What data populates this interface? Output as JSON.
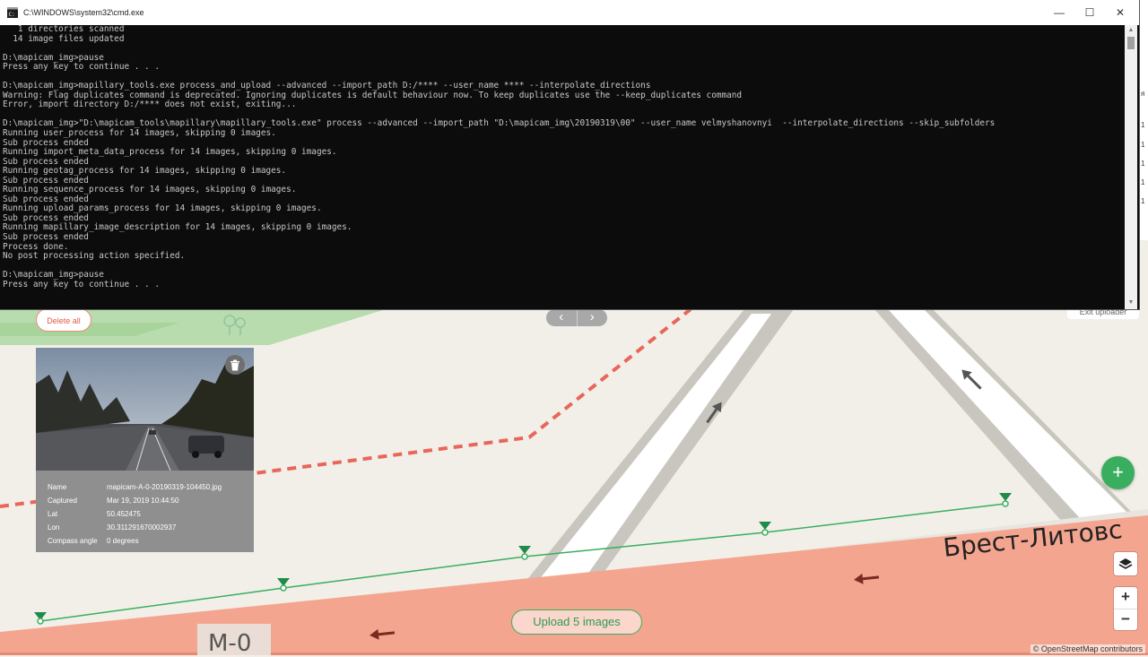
{
  "cmd": {
    "title": "C:\\WINDOWS\\system32\\cmd.exe",
    "controls": {
      "minimize": "—",
      "maximize": "☐",
      "close": "✕"
    },
    "lines": [
      "   1 directories scanned",
      "  14 image files updated",
      "",
      "D:\\mapicam_img>pause",
      "Press any key to continue . . .",
      "",
      "D:\\mapicam_img>mapillary_tools.exe process_and_upload --advanced --import_path D:/**** --user_name **** --interpolate_directions",
      "Warning: Flag duplicates command is deprecated. Ignoring duplicates is default behaviour now. To keep duplicates use the --keep_duplicates command",
      "Error, import directory D:/**** does not exist, exiting...",
      "",
      "D:\\mapicam_img>\"D:\\mapicam_tools\\mapillary\\mapillary_tools.exe\" process --advanced --import_path \"D:\\mapicam_img\\20190319\\00\" --user_name velmyshanovnyi  --interpolate_directions --skip_subfolders",
      "Running user_process for 14 images, skipping 0 images.",
      "Sub process ended",
      "Running import_meta_data_process for 14 images, skipping 0 images.",
      "Sub process ended",
      "Running geotag_process for 14 images, skipping 0 images.",
      "Sub process ended",
      "Running sequence_process for 14 images, skipping 0 images.",
      "Sub process ended",
      "Running upload_params_process for 14 images, skipping 0 images.",
      "Sub process ended",
      "Running mapillary_image_description for 14 images, skipping 0 images.",
      "Sub process ended",
      "Process done.",
      "No post processing action specified.",
      "",
      "D:\\mapicam_img>pause",
      "Press any key to continue . . ."
    ]
  },
  "uploader": {
    "delete_all_label": "Delete all",
    "exit_label": "Exit uploader",
    "pager": {
      "prev": "‹",
      "next": "›"
    },
    "upload_label": "Upload 5 images",
    "photo": {
      "fields": [
        {
          "key": "Name",
          "value": "mapicam-A-0-20190319-104450.jpg"
        },
        {
          "key": "Captured",
          "value": "Mar 19, 2019 10:44:50"
        },
        {
          "key": "Lat",
          "value": "50.452475"
        },
        {
          "key": "Lon",
          "value": "30.311291670002937"
        },
        {
          "key": "Compass angle",
          "value": "0 degrees"
        }
      ]
    },
    "add_icon": "+",
    "zoom_in": "+",
    "zoom_out": "−"
  },
  "map": {
    "street_label": "Брест-Литовс",
    "road_label": "М-0",
    "attribution": "© OpenStreetMap contributors"
  },
  "background_window": {
    "glyphs": [
      "я",
      "1",
      "1",
      "1",
      "1",
      "1"
    ]
  },
  "colors": {
    "accent_green": "#39ae5e",
    "road_salmon": "#f4a58f",
    "boundary_red": "#e8665a",
    "terminal_bg": "#0c0c0c"
  },
  "icons": [
    "cmd-icon",
    "minimize-icon",
    "maximize-icon",
    "close-icon",
    "trash-icon",
    "plus-icon",
    "layers-icon",
    "chevron-left-icon",
    "chevron-right-icon",
    "camera-marker-icon"
  ]
}
